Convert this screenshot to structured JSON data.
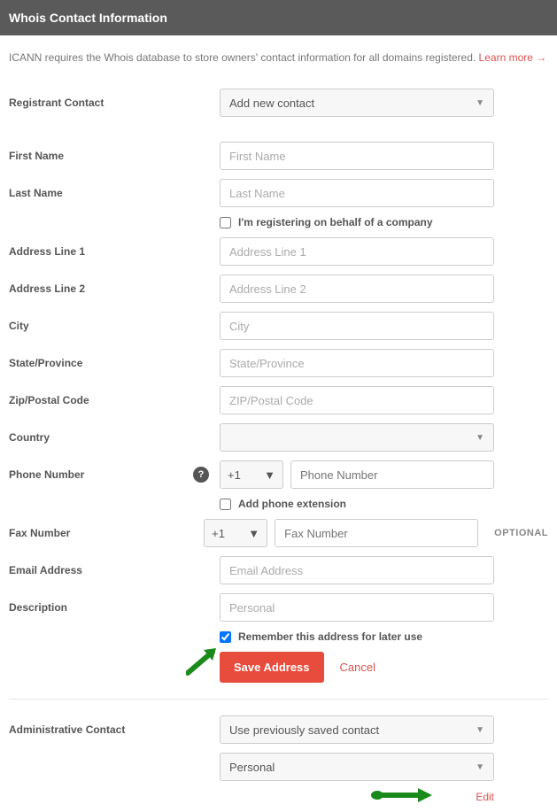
{
  "header": {
    "title": "Whois Contact Information"
  },
  "intro": {
    "text": "ICANN requires the Whois database to store owners' contact information for all domains registered.",
    "link": "Learn more →"
  },
  "registrant": {
    "title": "Registrant Contact",
    "contact_select": "Add new contact",
    "labels": {
      "first_name": "First Name",
      "last_name": "Last Name",
      "address1": "Address Line 1",
      "address2": "Address Line 2",
      "city": "City",
      "state": "State/Province",
      "zip": "Zip/Postal Code",
      "country": "Country",
      "phone": "Phone Number",
      "fax": "Fax Number",
      "email": "Email Address",
      "description": "Description"
    },
    "placeholders": {
      "first_name": "First Name",
      "last_name": "Last Name",
      "address1": "Address Line 1",
      "address2": "Address Line 2",
      "city": "City",
      "state": "State/Province",
      "zip": "ZIP/Postal Code",
      "phone": "Phone Number",
      "fax": "Fax Number",
      "email": "Email Address",
      "description": "Personal"
    },
    "company_checkbox": "I'm registering on behalf of a company",
    "phone_code": "+1",
    "fax_code": "+1",
    "add_extension": "Add phone extension",
    "optional": "OPTIONAL",
    "remember": "Remember this address for later use",
    "save_btn": "Save Address",
    "cancel": "Cancel",
    "help": "?"
  },
  "admin": {
    "title": "Administrative Contact",
    "select1": "Use previously saved contact",
    "select2": "Personal",
    "edit": "Edit"
  }
}
